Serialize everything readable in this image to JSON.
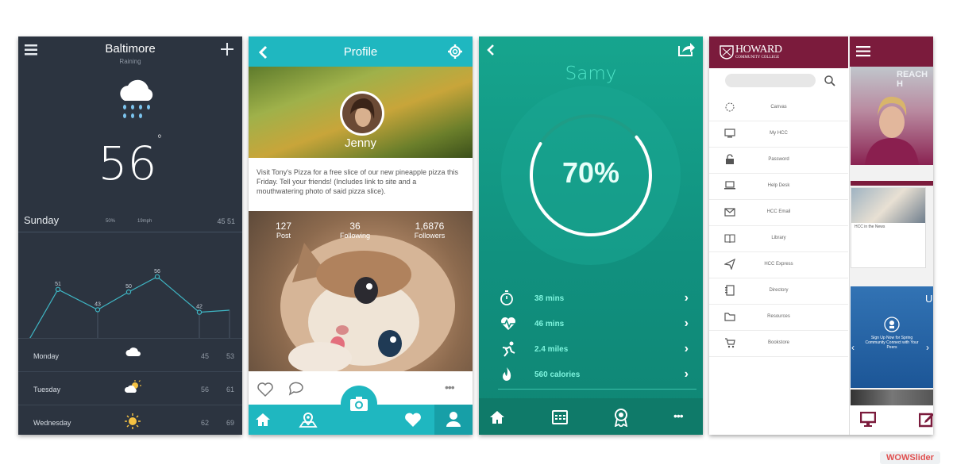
{
  "weather": {
    "city": "Baltimore",
    "condition": "Raining",
    "temperature": "56",
    "degree": "°",
    "today": {
      "day": "Sunday",
      "meta1": "50%",
      "meta2": "19mph",
      "high_low": "45  51"
    },
    "chart_points": [
      51,
      43,
      50,
      56,
      42
    ],
    "forecast": [
      {
        "day": "Monday",
        "icon": "cloud-icon",
        "high": "45",
        "low": "53"
      },
      {
        "day": "Tuesday",
        "icon": "partly-sunny-icon",
        "high": "56",
        "low": "61"
      },
      {
        "day": "Wednesday",
        "icon": "sun-icon",
        "high": "62",
        "low": "69"
      }
    ]
  },
  "profile": {
    "title": "Profile",
    "name": "Jenny",
    "post_text": "Visit Tony's Pizza for a free slice of our new pineapple pizza this Friday. Tell your friends! (Includes link to site and a mouthwatering photo of said pizza slice).",
    "stats": [
      {
        "value": "127",
        "label": "Post"
      },
      {
        "value": "36",
        "label": "Following"
      },
      {
        "value": "1,6876",
        "label": "Followers"
      }
    ],
    "more": "•••"
  },
  "fitness": {
    "name": "Samy",
    "percent": "70%",
    "progress": 0.7,
    "stats": [
      {
        "label": "38 mins",
        "icon": "stopwatch-icon"
      },
      {
        "label": "46 mins",
        "icon": "heart-rate-icon"
      },
      {
        "label": "2.4 miles",
        "icon": "running-icon"
      },
      {
        "label": "560 calories",
        "icon": "flame-icon"
      }
    ],
    "more": "•••"
  },
  "howard": {
    "logo_main": "HOWARD",
    "logo_sub": "COMMUNITY COLLEGE",
    "menu": [
      {
        "label": "Canvas",
        "icon": "canvas-icon"
      },
      {
        "label": "My HCC",
        "icon": "computer-icon"
      },
      {
        "label": "Password",
        "icon": "lock-icon"
      },
      {
        "label": "Help Desk",
        "icon": "laptop-icon"
      },
      {
        "label": "HCC Email",
        "icon": "envelope-icon"
      },
      {
        "label": "Library",
        "icon": "book-icon"
      },
      {
        "label": "HCC Express",
        "icon": "send-icon"
      },
      {
        "label": "Directory",
        "icon": "directory-icon"
      },
      {
        "label": "Resources",
        "icon": "folder-icon"
      },
      {
        "label": "Bookstore",
        "icon": "cart-icon"
      }
    ],
    "image_text": "REACH H",
    "card_text": "HCC in the News",
    "blue_text": "Sign Up Now for Spring Community Connect with Your Peers",
    "blue_up": "Up"
  },
  "watermark": "WOWSlider",
  "colors": {
    "weather_bg": "#2c3440",
    "profile_accent": "#1fb7c0",
    "fitness_bg": "#16a58e",
    "howard_brand": "#7b1b3c"
  }
}
